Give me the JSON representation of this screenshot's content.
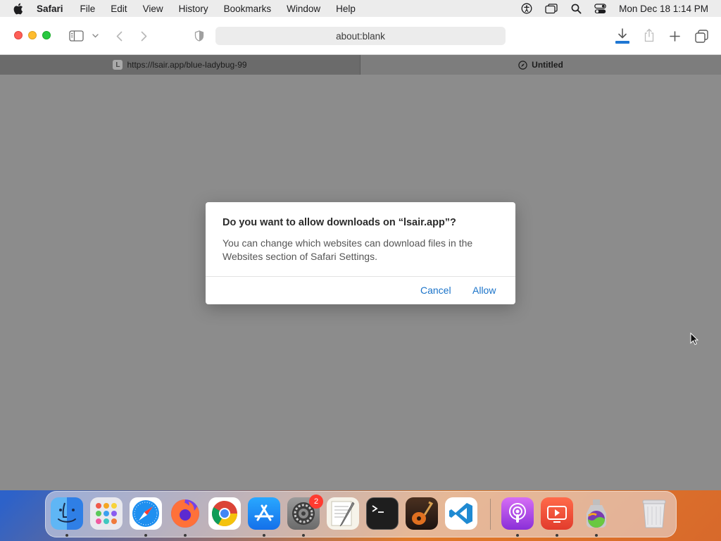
{
  "menubar": {
    "app_name": "Safari",
    "items": [
      "File",
      "Edit",
      "View",
      "History",
      "Bookmarks",
      "Window",
      "Help"
    ],
    "datetime": "Mon Dec 18  1:14 PM"
  },
  "toolbar": {
    "address": "about:blank"
  },
  "tabs": [
    {
      "favicon": "L",
      "label": "https://lsair.app/blue-ladybug-99"
    },
    {
      "label": "Untitled"
    }
  ],
  "dialog": {
    "title": "Do you want to allow downloads on “lsair.app”?",
    "message": "You can change which websites can download files in the Websites section of Safari Settings.",
    "cancel_label": "Cancel",
    "allow_label": "Allow"
  },
  "dock": {
    "settings_badge": "2",
    "apps": [
      "finder-icon",
      "launchpad-icon",
      "safari-icon",
      "firefox-icon",
      "chrome-icon",
      "app-store-icon",
      "system-settings-icon",
      "textedit-icon",
      "terminal-icon",
      "garageband-icon",
      "vscode-icon",
      "podcasts-icon",
      "screen-recorder-icon",
      "monterey-installer-icon",
      "trash-icon"
    ]
  },
  "colors": {
    "accent": "#1a73c9",
    "close": "#fe5f57",
    "minimize": "#febc2e",
    "maximize": "#28c840",
    "badge": "#ff3b30"
  }
}
